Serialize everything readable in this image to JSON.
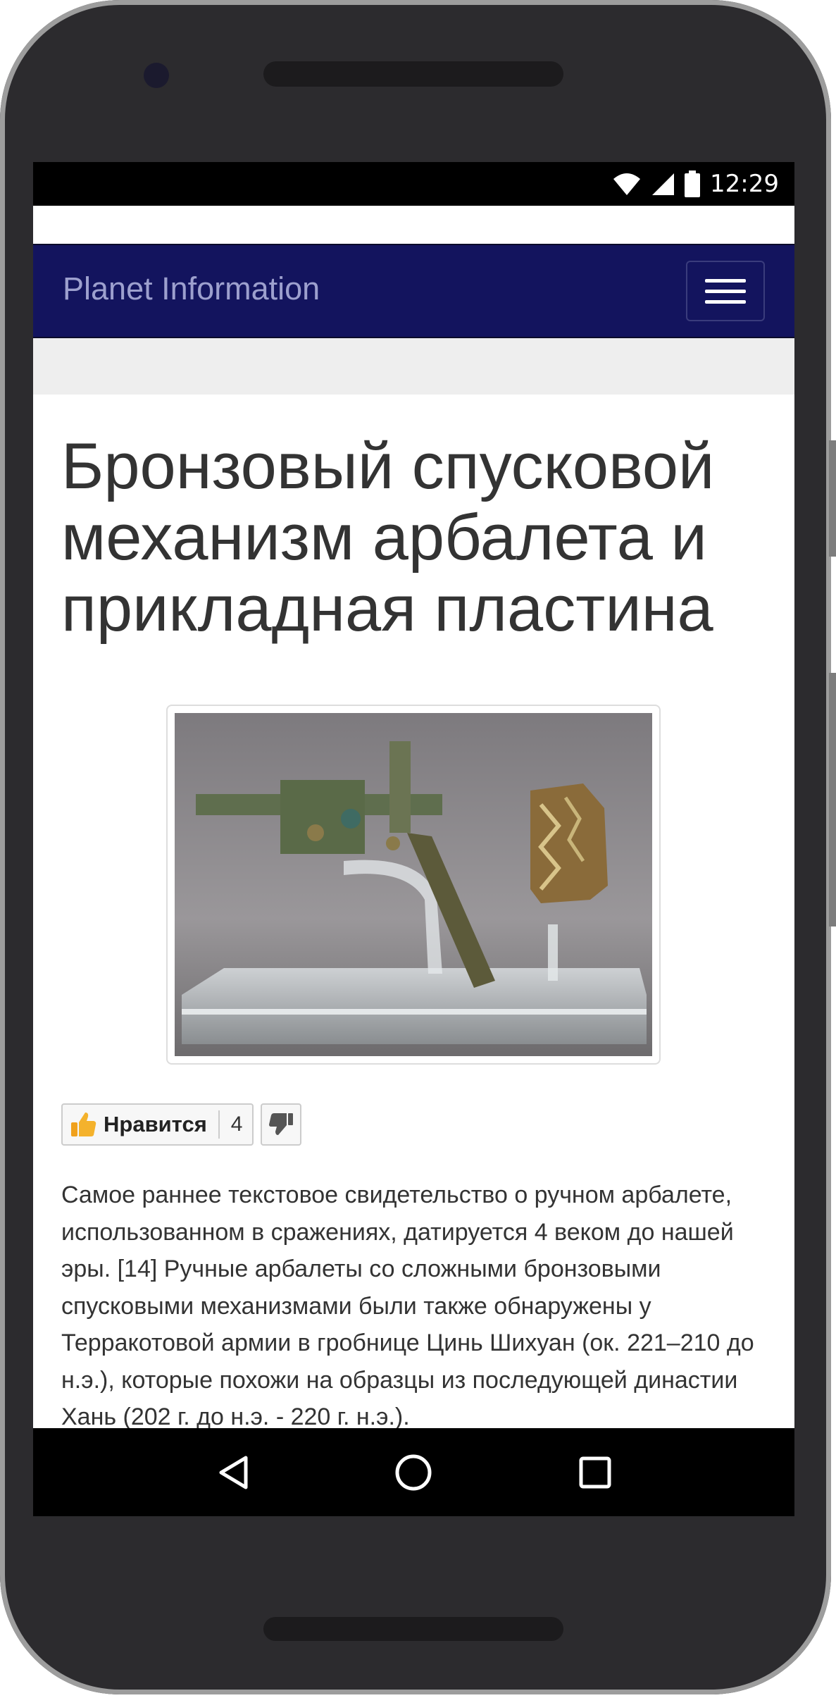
{
  "status_bar": {
    "time": "12:29"
  },
  "navbar": {
    "brand": "Planet Information"
  },
  "article": {
    "title": "Бронзовый спусковой механизм арбалета и прикладная пластина",
    "image_alt": "Бронзовый спусковой механизм арбалета и прикладная пластина",
    "like": {
      "label": "Нравится",
      "count": "4"
    },
    "body": "Самое раннее текстовое свидетельство о ручном арбалете, использованном в сражениях, датируется 4 веком до нашей эры. [14] Ручные арбалеты со сложными бронзовыми спусковыми механизмами были также обнаружены у Терракотовой армии в гробнице Цинь Шихуан (ок. 221–210 до н.э.), которые похожи на образцы из последующей династии Хань (202 г. до н.э. - 220 г. н.э.)."
  },
  "colors": {
    "navbar": "#13145e",
    "brand_text": "#9da0ce",
    "body_text": "#333333"
  },
  "icons": [
    "wifi-icon",
    "signal-icon",
    "battery-icon",
    "menu-icon",
    "thumbs-up-icon",
    "thumbs-down-icon",
    "back-icon",
    "home-icon",
    "recents-icon"
  ]
}
